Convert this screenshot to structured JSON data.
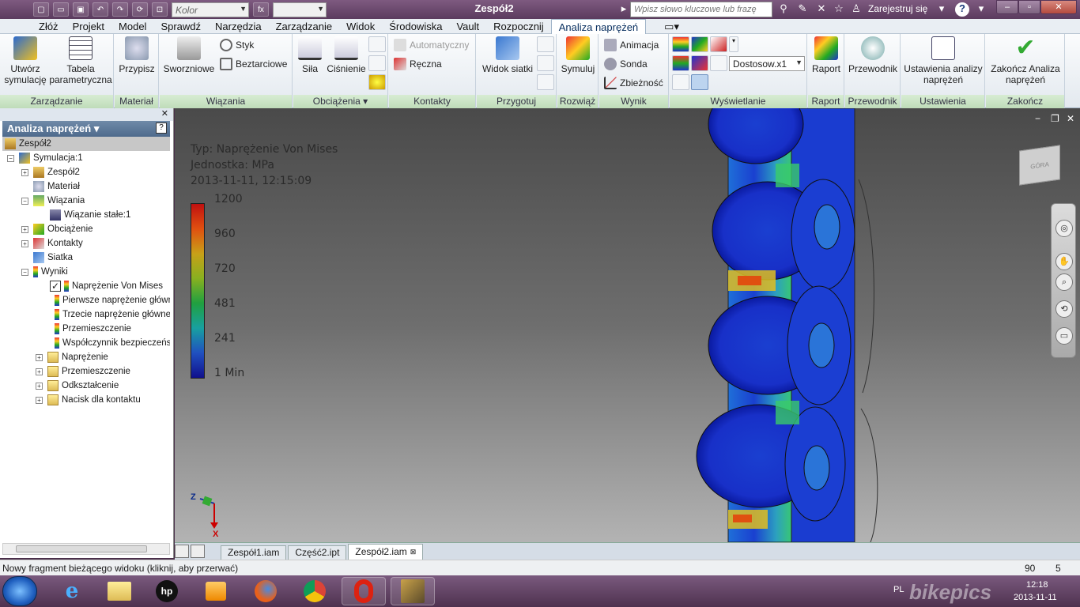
{
  "window": {
    "title": "Zespół2",
    "material_placeholder": "Kolor",
    "search_placeholder": "Wpisz słowo kluczowe lub frazę",
    "signin": "Zarejestruj się"
  },
  "menu": [
    "Złóż",
    "Projekt",
    "Model",
    "Sprawdź",
    "Narzędzia",
    "Zarządzanie",
    "Widok",
    "Środowiska",
    "Vault",
    "Rozpocznij",
    "Analiza naprężeń"
  ],
  "ribbon": {
    "utworz": "Utwórz symulację",
    "tabela": "Tabela parametryczna",
    "przypisz": "Przypisz",
    "sworzniowe": "Sworzniowe",
    "styk": "Styk",
    "beztarciowe": "Beztarciowe",
    "sila": "Siła",
    "cisnienie": "Ciśnienie",
    "automatyczny": "Automatyczny",
    "reczna": "Ręczna",
    "widok_siatki": "Widok siatki",
    "symuluj": "Symuluj",
    "animacja": "Animacja",
    "sonda": "Sonda",
    "zbieznosc": "Zbieżność",
    "dostosow": "Dostosow.x1",
    "raport": "Raport",
    "przewodnik": "Przewodnik",
    "ustawienia": "Ustawienia analizy naprężeń",
    "zakoncz": "Zakończ Analiza naprężeń",
    "groups": {
      "zarzadzanie": "Zarządzanie",
      "material": "Materiał",
      "wiazania": "Wiązania",
      "obciazenia": "Obciążenia",
      "kontakty": "Kontakty",
      "przygotuj": "Przygotuj",
      "rozwiaz": "Rozwiąż",
      "wynik": "Wynik",
      "wyswietlanie": "Wyświetlanie",
      "raport": "Raport",
      "przewodnik": "Przewodnik",
      "ustawienia": "Ustawienia",
      "zakoncz": "Zakończ"
    }
  },
  "browser": {
    "header": "Analiza naprężeń",
    "help": "?",
    "items": {
      "root": "Zespół2",
      "sym": "Symulacja:1",
      "assy": "Zespół2",
      "mat": "Materiał",
      "wia": "Wiązania",
      "wia1": "Wiązanie stałe:1",
      "obc": "Obciążenie",
      "kon": "Kontakty",
      "sia": "Siatka",
      "wyn": "Wyniki",
      "vm": "Naprężenie Von Mises",
      "p1": "Pierwsze naprężenie główne",
      "p3": "Trzecie naprężenie główne",
      "disp": "Przemieszczenie",
      "sf": "Współczynnik bezpieczeństwa",
      "nap": "Naprężenie",
      "prz": "Przemieszczenie",
      "odk": "Odkształcenie",
      "nac": "Nacisk dla kontaktu"
    }
  },
  "viewport": {
    "type_label": "Typ: Naprężenie Von Mises",
    "unit_label": "Jednostka: MPa",
    "date_label": "2013-11-11, 12:15:09",
    "scale": [
      "1200",
      "960",
      "720",
      "481",
      "241",
      "1 Min"
    ],
    "viewcube_label": "GÓRA",
    "axis_z": "Z",
    "axis_x": "X"
  },
  "tabs": [
    "Zespół1.iam",
    "Część2.ipt",
    "Zespół2.iam"
  ],
  "status": {
    "text": "Nowy fragment bieżącego widoku (kliknij, aby przerwać)",
    "n1": "90",
    "n2": "5"
  },
  "taskbar": {
    "lang": "PL",
    "time": "12:18",
    "date": "2013-11-11",
    "watermark": "bikepics"
  }
}
